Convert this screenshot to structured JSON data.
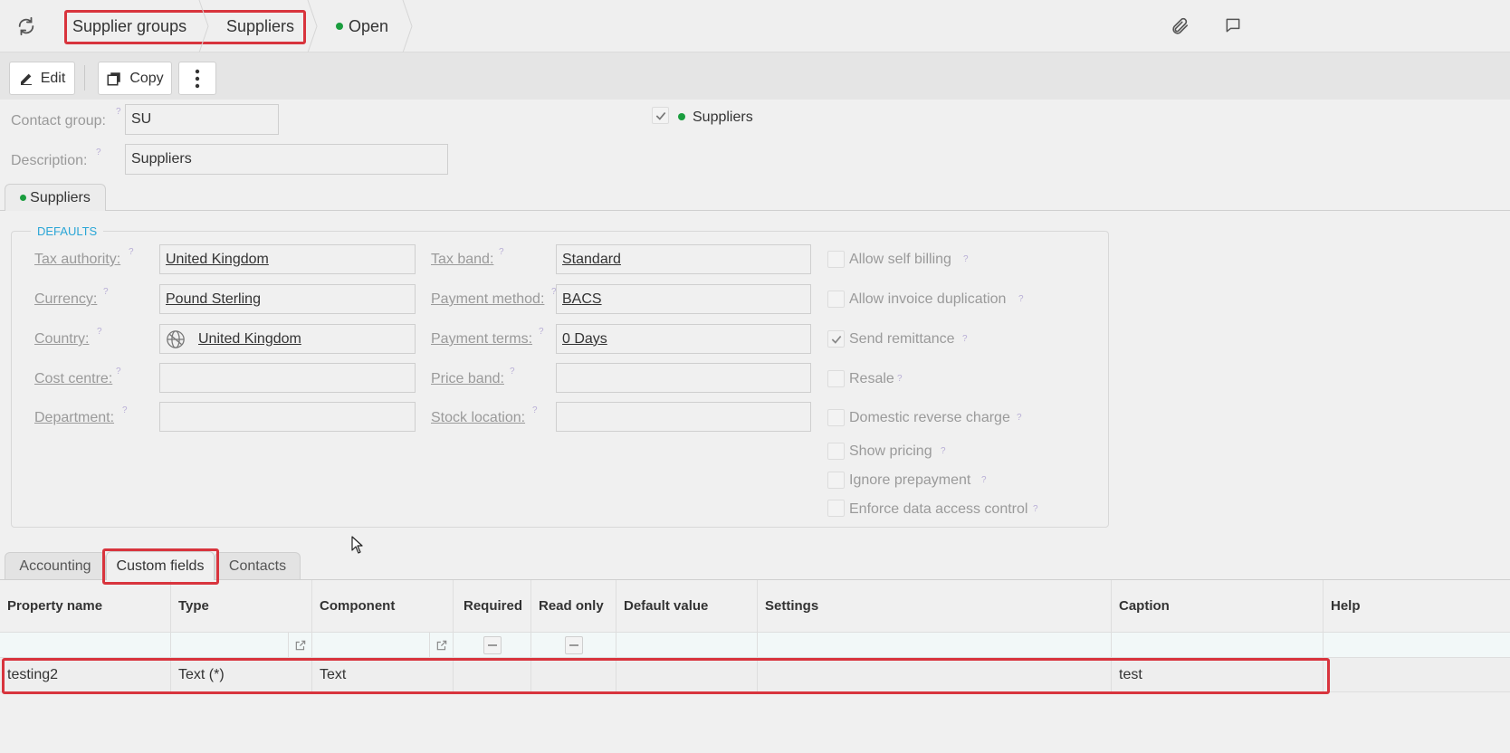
{
  "breadcrumb": {
    "item1": "Supplier groups",
    "item2": "Suppliers",
    "status": "Open"
  },
  "toolbar": {
    "edit_label": "Edit",
    "copy_label": "Copy"
  },
  "header": {
    "contact_group_label": "Contact group:",
    "contact_group_value": "SU",
    "description_label": "Description:",
    "description_value": "Suppliers",
    "suppliers_flag_label": "Suppliers"
  },
  "section_tab": "Suppliers",
  "defaults": {
    "legend": "DEFAULTS",
    "tax_authority_label": "Tax authority:",
    "tax_authority_value": "United Kingdom",
    "currency_label": "Currency:",
    "currency_value": "Pound Sterling",
    "country_label": "Country:",
    "country_value": "United Kingdom",
    "cost_centre_label": "Cost centre:",
    "cost_centre_value": "",
    "department_label": "Department:",
    "department_value": "",
    "tax_band_label": "Tax band:",
    "tax_band_value": "Standard",
    "payment_method_label": "Payment method:",
    "payment_method_value": "BACS",
    "payment_terms_label": "Payment terms:",
    "payment_terms_value": "0 Days",
    "price_band_label": "Price band:",
    "price_band_value": "",
    "stock_location_label": "Stock location:",
    "stock_location_value": "",
    "checkboxes": [
      {
        "label": "Allow self billing",
        "checked": false
      },
      {
        "label": "Allow invoice duplication",
        "checked": false
      },
      {
        "label": "Send remittance",
        "checked": true
      },
      {
        "label": "Resale",
        "checked": false
      },
      {
        "label": "Domestic reverse charge",
        "checked": false
      },
      {
        "label": "Show pricing",
        "checked": false
      },
      {
        "label": "Ignore prepayment",
        "checked": false
      },
      {
        "label": "Enforce data access control",
        "checked": false
      }
    ]
  },
  "tabs": {
    "accounting": "Accounting",
    "custom_fields": "Custom fields",
    "contacts": "Contacts"
  },
  "grid": {
    "columns": [
      "Property name",
      "Type",
      "Component",
      "Required",
      "Read only",
      "Default value",
      "Settings",
      "Caption",
      "Help"
    ],
    "rows": [
      {
        "property_name": "testing2",
        "type": "Text (*)",
        "component": "Text",
        "required": "",
        "read_only": "",
        "default_value": "",
        "settings": "",
        "caption": "test",
        "help": ""
      }
    ]
  },
  "colors": {
    "accent_red": "#d8343d",
    "status_green": "#1a9d3e",
    "legend_blue": "#2aa6d6"
  },
  "icons": [
    "refresh-icon",
    "paperclip-icon",
    "comment-icon",
    "pencil-icon",
    "copy-icon",
    "more-vertical-icon",
    "globe-icon",
    "external-link-icon",
    "checkmark-icon"
  ]
}
